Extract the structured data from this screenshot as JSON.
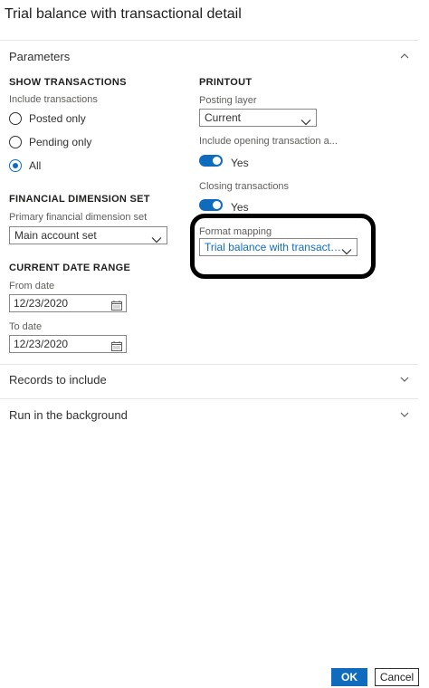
{
  "dialog": {
    "title": "Trial balance with transactional detail"
  },
  "sections": {
    "parameters": {
      "label": "Parameters"
    },
    "records": {
      "label": "Records to include"
    },
    "background": {
      "label": "Run in the background"
    }
  },
  "show_transactions": {
    "title": "SHOW TRANSACTIONS",
    "label": "Include transactions",
    "options": [
      {
        "label": "Posted only",
        "checked": false
      },
      {
        "label": "Pending only",
        "checked": false
      },
      {
        "label": "All",
        "checked": true
      }
    ]
  },
  "financial_dimension": {
    "title": "FINANCIAL DIMENSION SET",
    "label": "Primary financial dimension set",
    "value": "Main account set"
  },
  "date_range": {
    "title": "CURRENT DATE RANGE",
    "from_label": "From date",
    "from_value": "12/23/2020",
    "to_label": "To date",
    "to_value": "12/23/2020"
  },
  "printout": {
    "title": "PRINTOUT",
    "posting_layer_label": "Posting layer",
    "posting_layer_value": "Current",
    "opening_label": "Include opening transaction a...",
    "opening_value": "Yes",
    "closing_label": "Closing transactions",
    "closing_value": "Yes",
    "format_mapping_label": "Format mapping",
    "format_mapping_value": "Trial balance with transacti..."
  },
  "buttons": {
    "ok": "OK",
    "cancel": "Cancel"
  },
  "colors": {
    "accent": "#0f6cbd",
    "highlight_border": "#000000"
  }
}
